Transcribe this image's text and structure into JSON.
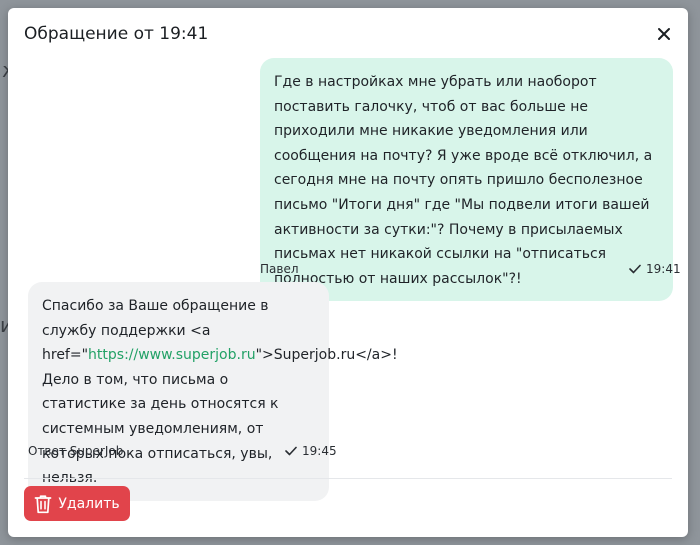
{
  "modal": {
    "title": "Обращение от 19:41",
    "close_icon": "close-icon"
  },
  "messages": [
    {
      "author": "Павел",
      "time": "19:41",
      "text": "Где в настройках мне убрать или наоборот поставить галочку, чтоб от вас больше не приходили мне никакие уведомления или сообщения на почту? Я уже вроде всё отключил, а сегодня мне на почту опять пришло бесполезное письмо \"Итоги дня\" где \"Мы подвели итоги вашей активности за сутки:\"? Почему в присылаемых письмах нет никакой ссылки на \"отписаться полностью от наших рассылок\"?!",
      "status_icon": "check-icon"
    },
    {
      "author": "Ответ SuperJob",
      "time": "19:45",
      "text_before": "Спасибо за Ваше обращение в службу поддержки <a href=\"",
      "link": "https://www.superjob.ru",
      "text_after": "\">Superjob.ru</a>!  Дело в том, что письма о статистике за день относятся к системным уведомлениям, от которых пока отписаться, увы, нельзя.",
      "status_icon": "check-icon"
    }
  ],
  "footer": {
    "delete_label": "Удалить",
    "delete_icon": "trash-icon",
    "delete_color": "#e1444b"
  },
  "colors": {
    "user_bubble": "#d8f5ea",
    "support_bubble": "#f1f2f3",
    "link": "#22a166"
  }
}
